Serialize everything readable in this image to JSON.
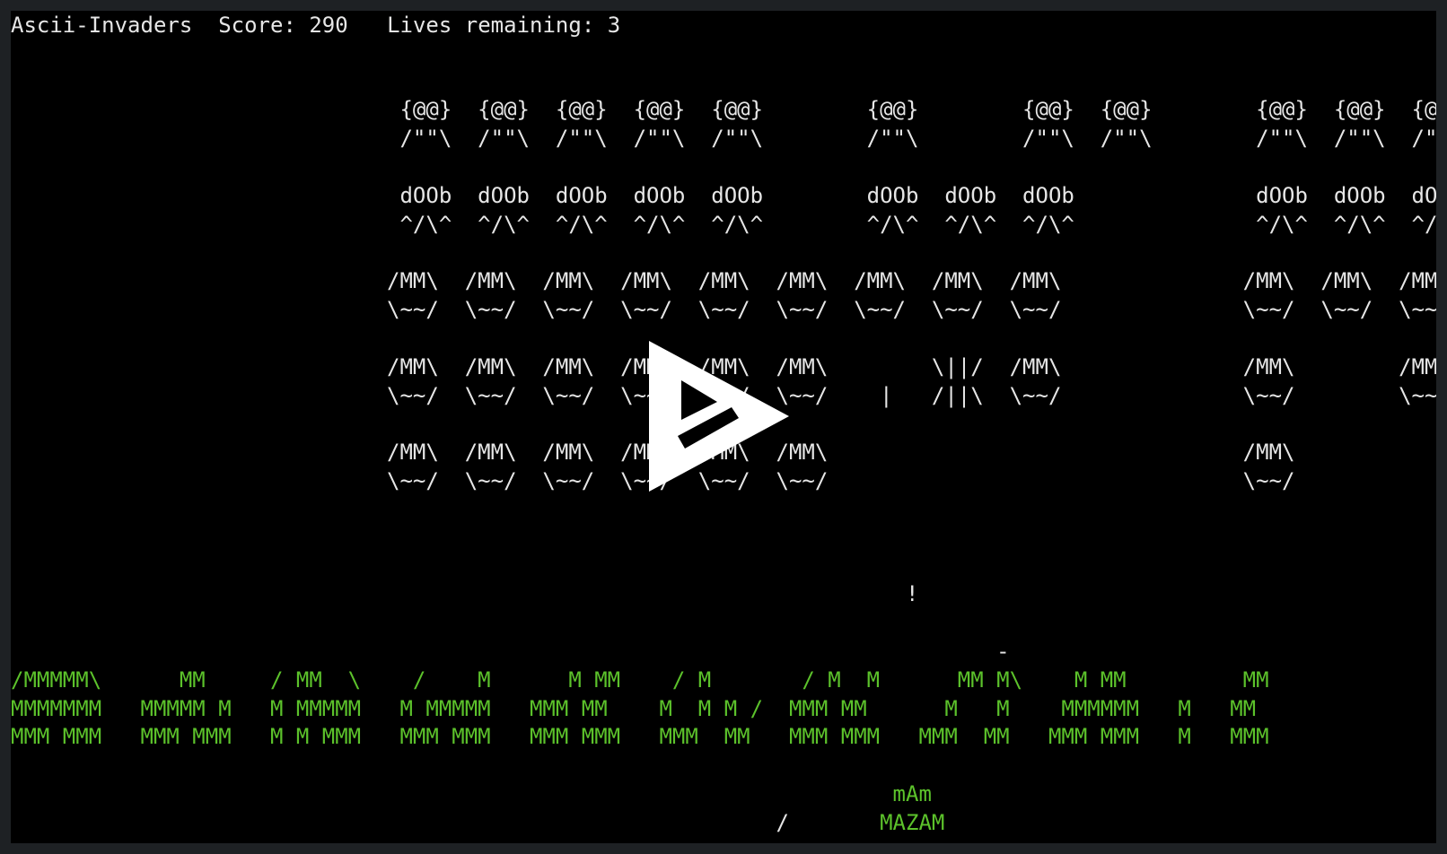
{
  "status": {
    "game_title": "Ascii-Invaders",
    "score_label": "Score:",
    "score": "290",
    "lives_label": "Lives remaining:",
    "lives": "3"
  },
  "invaders": {
    "rows": [
      "                              {@@}  {@@}  {@@}  {@@}  {@@}        {@@}        {@@}  {@@}        {@@}  {@@}  {@@}",
      "                              /\"\"\\  /\"\"\\  /\"\"\\  /\"\"\\  /\"\"\\        /\"\"\\        /\"\"\\  /\"\"\\        /\"\"\\  /\"\"\\  /\"\"\\",
      "                              dOOb  dOOb  dOOb  dOOb  dOOb        dOOb  dOOb  dOOb              dOOb  dOOb  dOOb",
      "                              ^/\\^  ^/\\^  ^/\\^  ^/\\^  ^/\\^        ^/\\^  ^/\\^  ^/\\^              ^/\\^  ^/\\^  ^/\\^",
      "                             /MM\\  /MM\\  /MM\\  /MM\\  /MM\\  /MM\\  /MM\\  /MM\\  /MM\\              /MM\\  /MM\\  /MM\\",
      "                             \\~~/  \\~~/  \\~~/  \\~~/  \\~~/  \\~~/  \\~~/  \\~~/  \\~~/              \\~~/  \\~~/  \\~~/",
      "                             /MM\\  /MM\\  /MM\\  /MM\\  /MM\\  /MM\\        \\||/  /MM\\              /MM\\        /MM\\",
      "                             \\~~/  \\~~/  \\~~/  \\~~/  \\~~/  \\~~/    |   /||\\  \\~~/              \\~~/        \\~~/",
      "                             /MM\\  /MM\\  /MM\\  /MM\\  /MM\\  /MM\\                                /MM\\",
      "                             \\~~/  \\~~/  \\~~/  \\~~/  \\~~/  \\~~/                                \\~~/"
    ]
  },
  "projectiles": {
    "bomb_row": "                                                                     !",
    "shot_row": "                                                                            -"
  },
  "shields": {
    "rows": [
      "/MMMMM\\      MM     / MM  \\    /    M      M MM    / M       / M  M      MM M\\    M MM         MM",
      "MMMMMMM   MMMMM M   M MMMMM   M MMMMM   MMM MM    M  M M /  MMM MM      M   M    MMMMMM   M   MM",
      "MMM MMM   MMM MMM   M M MMM   MMM MMM   MMM MMM   MMM  MM   MMM MMM   MMM  MM   MMM MMM   M   MMM"
    ]
  },
  "player": {
    "cannon_top": "                                                                    mAm",
    "cannon_bottom": "                                                           /       MAZAM"
  },
  "colors": {
    "background": "#000000",
    "text": "#e6e6e6",
    "green": "#5cc22b"
  },
  "overlay": {
    "icon": "asciinema-play-icon"
  }
}
